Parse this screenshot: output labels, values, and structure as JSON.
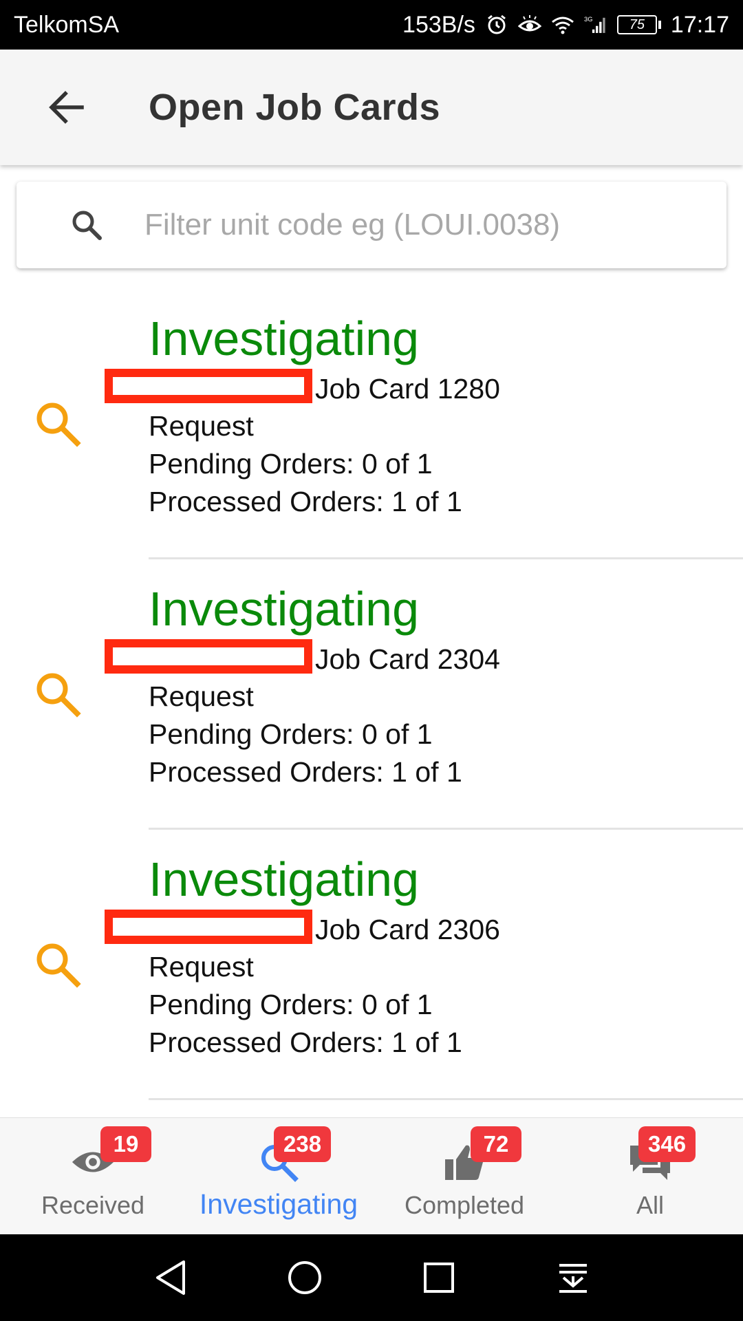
{
  "status_bar": {
    "carrier": "TelkomSA",
    "net_speed": "153B/s",
    "network": "3G",
    "battery": "75",
    "time": "17:17"
  },
  "app_bar": {
    "title": "Open Job Cards",
    "back_icon": "arrow-left-icon"
  },
  "search": {
    "placeholder": "Filter unit code eg (LOUI.0038)",
    "value": "",
    "icon": "search-icon"
  },
  "jobs": [
    {
      "status": "Investigating",
      "title": "Job Card 1280",
      "type": "Request",
      "pending": "Pending Orders: 0 of 1",
      "processed": "Processed Orders: 1 of 1"
    },
    {
      "status": "Investigating",
      "title": "Job Card 2304",
      "type": "Request",
      "pending": "Pending Orders: 0 of 1",
      "processed": "Processed Orders: 1 of 1"
    },
    {
      "status": "Investigating",
      "title": "Job Card 2306",
      "type": "Request",
      "pending": "Pending Orders: 0 of 1",
      "processed": "Processed Orders: 1 of 1"
    }
  ],
  "bottom_nav": {
    "items": [
      {
        "label": "Received",
        "badge": "19",
        "icon": "eye-icon"
      },
      {
        "label": "Investigating",
        "badge": "238",
        "icon": "search-icon",
        "active": true
      },
      {
        "label": "Completed",
        "badge": "72",
        "icon": "thumbs-up-icon"
      },
      {
        "label": "All",
        "badge": "346",
        "icon": "chat-icon"
      }
    ]
  },
  "colors": {
    "status_green": "#0a8a0a",
    "icon_orange": "#f5a00f",
    "active_blue": "#4285f4",
    "badge_red": "#f0383d",
    "redaction_red": "#ff2a10"
  }
}
